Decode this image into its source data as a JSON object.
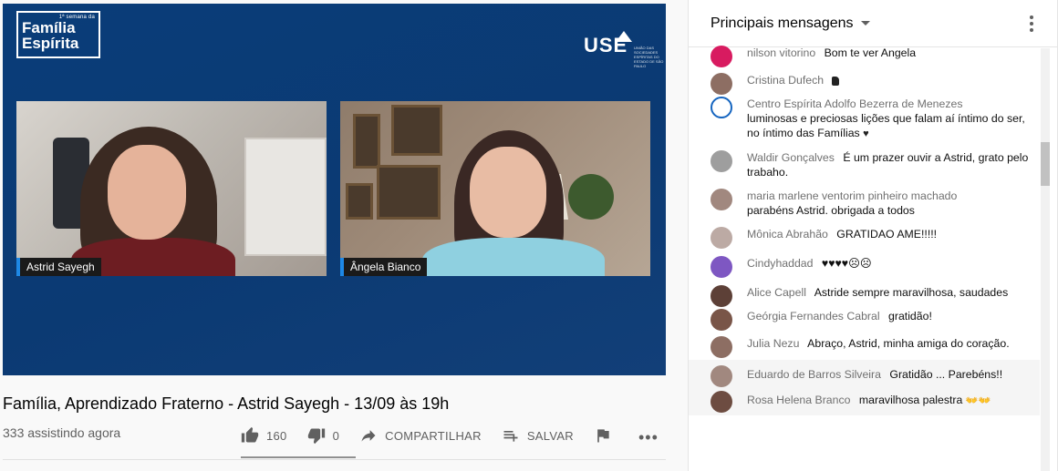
{
  "player": {
    "brand_small": "1ª semana da",
    "brand_line1": "Família",
    "brand_line2": "Espírita",
    "partner_logo": "USE",
    "partner_sub": "UNIÃO DAS SOCIEDADES ESPÍRITAS DO ESTADO DE SÃO PAULO",
    "cams": [
      {
        "name": "Astrid Sayegh"
      },
      {
        "name": "Ângela Bianco"
      }
    ]
  },
  "video": {
    "title": "Família, Aprendizado Fraterno - Astrid Sayegh - 13/09 às 19h",
    "viewers": "333 assistindo agora",
    "likes": "160",
    "dislikes": "0",
    "share_label": "COMPARTILHAR",
    "save_label": "SALVAR",
    "more_label": "•••",
    "like_ratio": 1.0
  },
  "chat": {
    "header_title": "Principais mensagens",
    "messages": [
      {
        "author": "nilson vitorino",
        "text": "Bom te ver Angela",
        "avatar_color": "#d81b60"
      },
      {
        "author": "Cristina Dufech",
        "text": "",
        "avatar_color": "#8d6e63"
      },
      {
        "author": "Centro Espírita Adolfo Bezerra de Menezes",
        "text": "luminosas e preciosas lições que falam aí íntimo do ser, no íntimo das Famílias",
        "avatar_color": "#1565c0"
      },
      {
        "author": "Waldir Gonçalves",
        "text": "É um prazer ouvir a Astrid, grato pelo trabaho.",
        "avatar_color": "#9e9e9e"
      },
      {
        "author": "maria marlene ventorim pinheiro machado",
        "text": "parabéns Astrid. obrigada a todos",
        "avatar_color": "#a1887f"
      },
      {
        "author": "Mônica Abrahão",
        "text": "GRATIDAO AME!!!!!",
        "avatar_color": "#bcaaa4"
      },
      {
        "author": "Cindyhaddad",
        "text": "♥♥♥♥☹☹",
        "avatar_color": "#7e57c2"
      },
      {
        "author": "Alice Capell",
        "text": "Astride sempre maravilhosa, saudades",
        "avatar_color": "#5d4037"
      },
      {
        "author": "Geórgia Fernandes Cabral",
        "text": "gratidão!",
        "avatar_color": "#795548"
      },
      {
        "author": "Julia Nezu",
        "text": "Abraço, Astrid, minha amiga do coração.",
        "avatar_color": "#8d6e63"
      },
      {
        "author": "Eduardo de Barros Silveira",
        "text": "Gratidão ... Parebéns!!",
        "avatar_color": "#a1887f"
      },
      {
        "author": "Rosa Helena Branco",
        "text": "maravilhosa palestra",
        "avatar_color": "#6d4c41"
      }
    ]
  }
}
